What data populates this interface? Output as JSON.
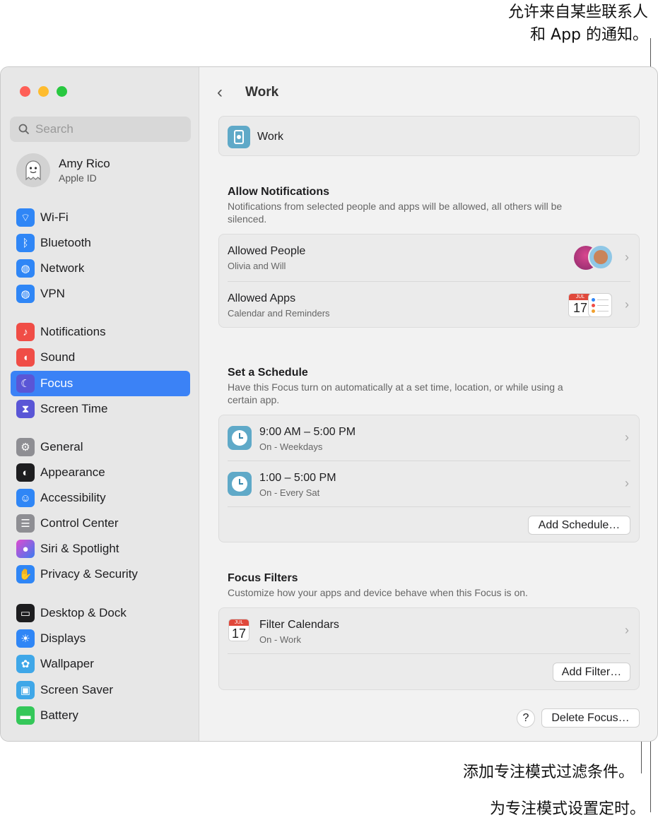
{
  "callouts": {
    "top_line1": "允许来自某些联系人",
    "top_line2": "和 App 的通知。",
    "filter": "添加专注模式过滤条件。",
    "schedule": "为专注模式设置定时。"
  },
  "search": {
    "placeholder": "Search"
  },
  "account": {
    "name": "Amy Rico",
    "sub": "Apple ID"
  },
  "sidebar": {
    "items": [
      {
        "label": "Wi-Fi",
        "icon": "wifi-icon",
        "color": "#2f86f6"
      },
      {
        "label": "Bluetooth",
        "icon": "bluetooth-icon",
        "color": "#2f86f6"
      },
      {
        "label": "Network",
        "icon": "globe-icon",
        "color": "#2f86f6"
      },
      {
        "label": "VPN",
        "icon": "vpn-icon",
        "color": "#2f86f6"
      },
      {
        "label": "Notifications",
        "icon": "bell-icon",
        "color": "#f04d46"
      },
      {
        "label": "Sound",
        "icon": "speaker-icon",
        "color": "#f04d46"
      },
      {
        "label": "Focus",
        "icon": "moon-icon",
        "color": "#5a56d6"
      },
      {
        "label": "Screen Time",
        "icon": "hourglass-icon",
        "color": "#5a56d6"
      },
      {
        "label": "General",
        "icon": "gear-icon",
        "color": "#8e8e93"
      },
      {
        "label": "Appearance",
        "icon": "appearance-icon",
        "color": "#1d1d1f"
      },
      {
        "label": "Accessibility",
        "icon": "accessibility-icon",
        "color": "#2f86f6"
      },
      {
        "label": "Control Center",
        "icon": "control-center-icon",
        "color": "#8e8e93"
      },
      {
        "label": "Siri & Spotlight",
        "icon": "siri-icon",
        "color": "#7a3df0"
      },
      {
        "label": "Privacy & Security",
        "icon": "hand-icon",
        "color": "#2f86f6"
      },
      {
        "label": "Desktop & Dock",
        "icon": "dock-icon",
        "color": "#1d1d1f"
      },
      {
        "label": "Displays",
        "icon": "sun-icon",
        "color": "#2f86f6"
      },
      {
        "label": "Wallpaper",
        "icon": "wallpaper-icon",
        "color": "#3fa7e8"
      },
      {
        "label": "Screen Saver",
        "icon": "screensaver-icon",
        "color": "#3fa7e8"
      },
      {
        "label": "Battery",
        "icon": "battery-icon",
        "color": "#34c759"
      }
    ]
  },
  "main": {
    "title": "Work",
    "focus_name": "Work",
    "allow": {
      "heading": "Allow Notifications",
      "desc": "Notifications from selected people and apps will be allowed, all others will be silenced.",
      "people_title": "Allowed People",
      "people_sub": "Olivia and Will",
      "apps_title": "Allowed Apps",
      "apps_sub": "Calendar and Reminders",
      "cal_month": "JUL",
      "cal_day": "17"
    },
    "schedule": {
      "heading": "Set a Schedule",
      "desc": "Have this Focus turn on automatically at a set time, location, or while using a certain app.",
      "items": [
        {
          "time": "9:00 AM – 5:00 PM",
          "sub": "On - Weekdays"
        },
        {
          "time": "1:00 – 5:00 PM",
          "sub": "On - Every Sat"
        }
      ],
      "add_button": "Add Schedule…"
    },
    "filters": {
      "heading": "Focus Filters",
      "desc": "Customize how your apps and device behave when this Focus is on.",
      "item_title": "Filter Calendars",
      "item_sub": "On - Work",
      "cal_month": "JUL",
      "cal_day": "17",
      "add_button": "Add Filter…"
    },
    "help_label": "?",
    "delete_button": "Delete Focus…"
  }
}
